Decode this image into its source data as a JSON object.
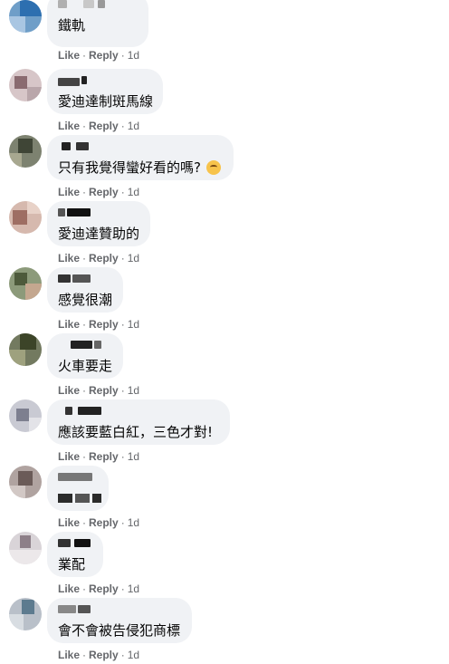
{
  "comments": [
    {
      "text": "鐵軌",
      "actions": {
        "like": "Like",
        "reply": "Reply",
        "time": "1d"
      }
    },
    {
      "text": "愛迪達制斑馬線",
      "actions": {
        "like": "Like",
        "reply": "Reply",
        "time": "1d"
      }
    },
    {
      "text": "只有我覺得蠻好看的嗎?",
      "emoji": "thinking-face",
      "actions": {
        "like": "Like",
        "reply": "Reply",
        "time": "1d"
      }
    },
    {
      "text": "愛迪達贊助的",
      "actions": {
        "like": "Like",
        "reply": "Reply",
        "time": "1d"
      }
    },
    {
      "text": "感覺很潮",
      "actions": {
        "like": "Like",
        "reply": "Reply",
        "time": "1d"
      }
    },
    {
      "text": "火車要走",
      "actions": {
        "like": "Like",
        "reply": "Reply",
        "time": "1d"
      }
    },
    {
      "text": "應該要藍白紅，三色才對!",
      "actions": {
        "like": "Like",
        "reply": "Reply",
        "time": "1d"
      }
    },
    {
      "text": "",
      "actions": {
        "like": "Like",
        "reply": "Reply",
        "time": "1d"
      }
    },
    {
      "text": "業配",
      "actions": {
        "like": "Like",
        "reply": "Reply",
        "time": "1d"
      }
    },
    {
      "text": "會不會被告侵犯商標",
      "actions": {
        "like": "Like",
        "reply": "Reply",
        "time": "1d"
      }
    }
  ],
  "colors": {
    "bubble": "#f0f2f5",
    "text": "#050505",
    "meta": "#65676b"
  }
}
